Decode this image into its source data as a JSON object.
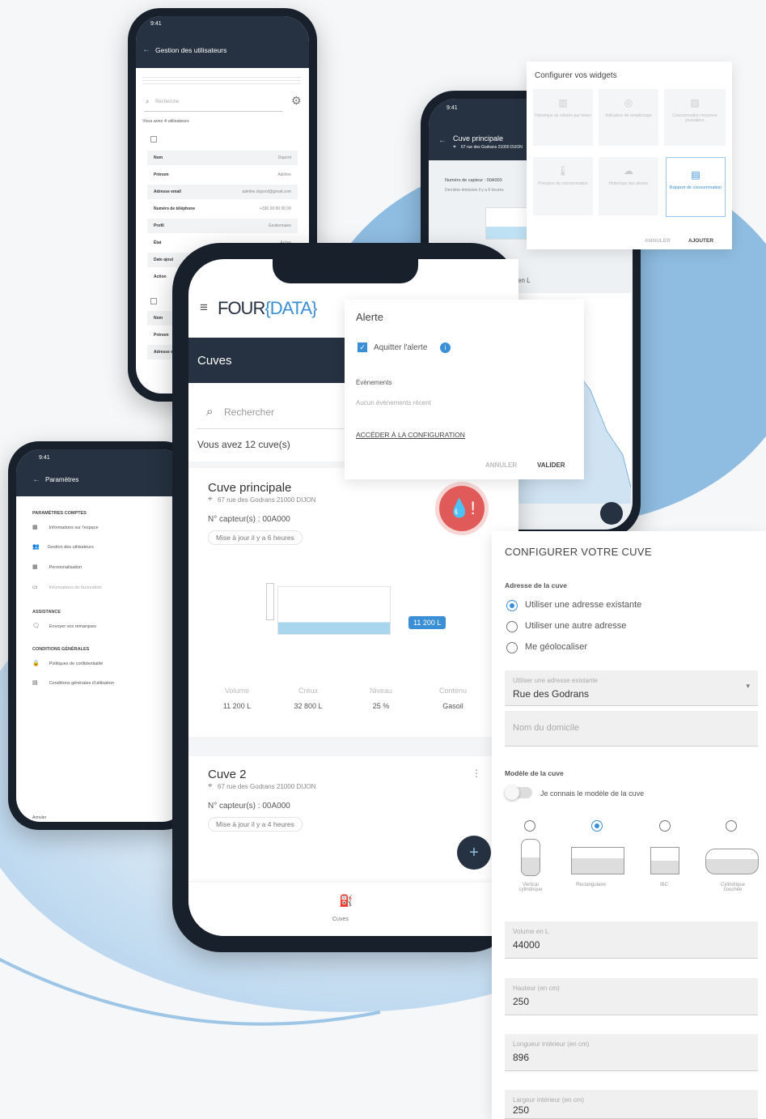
{
  "colors": {
    "dark": "#263241",
    "accent": "#3a8fd6",
    "alert": "#e05a5a",
    "water": "#9ad0ee"
  },
  "brand": {
    "four": "FOUR",
    "data": "DATA"
  },
  "users_phone": {
    "status_time": "9:41",
    "title": "Gestion des utilisateurs",
    "search_placeholder": "Recherche",
    "count_text": "Vous avez 4 utilisateurs",
    "rows": [
      {
        "label": "Nom",
        "value": "Dupont"
      },
      {
        "label": "Prénom",
        "value": "Adeline"
      },
      {
        "label": "Adresse email",
        "value": "adeline.dupont@gmail.com"
      },
      {
        "label": "Numéro de téléphone",
        "value": "+336 00 00 00 00"
      },
      {
        "label": "Profil",
        "value": "Gestionnaire"
      },
      {
        "label": "État",
        "value": "Active"
      },
      {
        "label": "Date ajout",
        "value": ""
      },
      {
        "label": "Action",
        "value": ""
      }
    ],
    "rows2": [
      "Nom",
      "Prénom",
      "Adresse e"
    ]
  },
  "settings_phone": {
    "status_time": "9:41",
    "title": "Paramètres",
    "section_accounts": "PARAMÈTRES COMPTES",
    "items_accounts": [
      "Informations sur l'espace",
      "Gestion des utilisateurs",
      "Personnalisation",
      "Informations de facturation"
    ],
    "section_help": "ASSISTANCE",
    "items_help": [
      "Envoyer vos remarques"
    ],
    "section_cond": "CONDITIONS GÉNÉRALES",
    "items_cond": [
      "Politiques de confidentialité",
      "Conditions générales d'utilisation"
    ],
    "footer": "Annuler"
  },
  "tank_phone_back": {
    "status_time": "9:41",
    "title": "Cuve principale",
    "address": "67 rue des Godrans 21000 DIJON",
    "sensor": "Numéro de capteur : 00A000",
    "updated": "Dernière émission il y a 6 heures",
    "suffix": "en L"
  },
  "widgets": {
    "title": "Configurer vos widgets",
    "items": [
      "Historique du volume par heure",
      "Indicateur de remplissage",
      "Consommation moyenne journalière",
      "Prévision de consommation",
      "Historique des alertes",
      "Rapport de consommation"
    ],
    "cancel": "ANNULER",
    "add": "AJOUTER"
  },
  "main_phone": {
    "header": "Cuves",
    "search_placeholder": "Rechercher",
    "count_text": "Vous avez 12 cuve(s)",
    "tanks": [
      {
        "name": "Cuve principale",
        "address": "67 rue des Godrans 21000 DIJON",
        "sensor": "N° capteur(s) : 00A000",
        "updated": "Mise à jour il y a 6 heures",
        "level_badge": "11 200 L",
        "stats": [
          {
            "k": "Volume",
            "v": "11 200 L"
          },
          {
            "k": "Creux",
            "v": "32 800 L"
          },
          {
            "k": "Niveau",
            "v": "25 %"
          },
          {
            "k": "Contenu",
            "v": "Gasoil"
          }
        ]
      },
      {
        "name": "Cuve 2",
        "address": "67 rue des Godrans 21000 DIJON",
        "sensor": "N° capteur(s) : 00A000",
        "updated": "Mise à jour il y a 4 heures"
      }
    ],
    "nav_label": "Cuves",
    "fab": "+"
  },
  "alert": {
    "title": "Alerte",
    "ack": "Aquitter l'alerte",
    "events_label": "Évènements",
    "events_empty": "Aucun évènements récent",
    "config_link": "ACCÉDER À LA CONFIGURATION",
    "cancel": "ANNULER",
    "validate": "VALIDER",
    "badge": "!"
  },
  "config": {
    "title": "CONFIGURER VOTRE CUVE",
    "address_section": "Adresse de la cuve",
    "options": [
      "Utiliser une adresse existante",
      "Utiliser une autre adresse",
      "Me géolocaliser"
    ],
    "select_label": "Utiliser une adresse existante",
    "select_value": "Rue des Godrans",
    "home_placeholder": "Nom du domicile",
    "model_section": "Modèle de la cuve",
    "model_toggle": "Je connais le modèle de la cuve",
    "models": [
      "Vertical cylindrique",
      "Rectangulaire",
      "IBC",
      "Cylindrique couchée"
    ],
    "fields": [
      {
        "label": "Volume en L",
        "value": "44000"
      },
      {
        "label": "Hauteur (en cm)",
        "value": "250"
      },
      {
        "label": "Longueur intérieur (en cm)",
        "value": "896"
      },
      {
        "label": "Largeur intérieur (en cm)",
        "value": "250"
      }
    ]
  }
}
